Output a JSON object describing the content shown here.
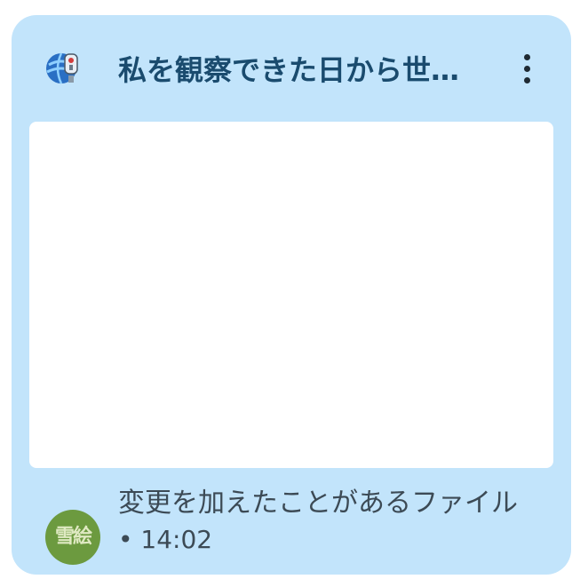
{
  "card": {
    "title": "私を観察できた日から世…",
    "app_icon": "world-globe-icon",
    "more_icon": "more-vert-icon",
    "thumbnail": "",
    "footer": {
      "badge_text": "雪絵",
      "badge_color": "#6c9a3f",
      "line1": "変更を加えたことがあるファイル",
      "line2": "• 14:02"
    }
  },
  "colors": {
    "card_bg": "#c2e4fb",
    "title": "#1a4b6e",
    "thumbnail_bg": "#ffffff"
  }
}
